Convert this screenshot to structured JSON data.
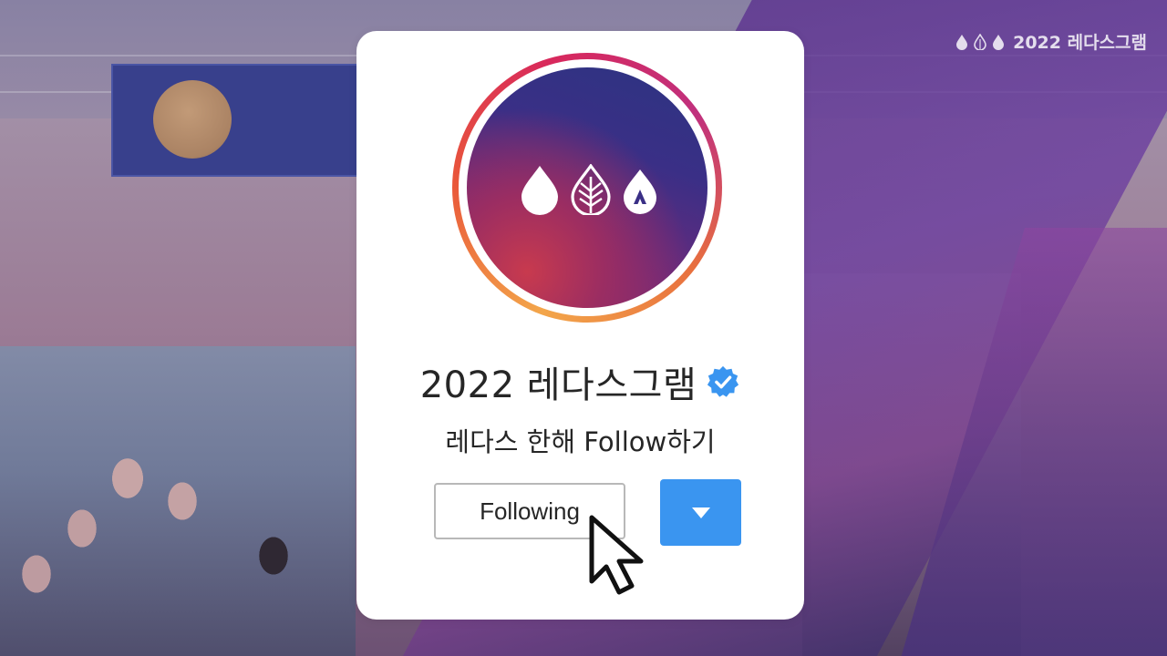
{
  "brand": {
    "watermark_text": "2022 레다스그램"
  },
  "profile": {
    "username": "2022 레다스그램",
    "subtitle": "레다스 한해 Follow하기",
    "verified_icon": "verified-badge-icon",
    "avatar_icons": [
      "drop-icon",
      "leaf-drop-icon",
      "a-drop-icon"
    ]
  },
  "actions": {
    "following_label": "Following",
    "dropdown_icon": "caret-down-icon"
  },
  "colors": {
    "button_blue": "#3a95f0",
    "ring_gradient": [
      "#f3a64a",
      "#e9573a",
      "#d8285c",
      "#c0307d"
    ],
    "avatar_gradient": [
      "#2c3481",
      "#6a2a7c",
      "#c83a4e"
    ]
  }
}
